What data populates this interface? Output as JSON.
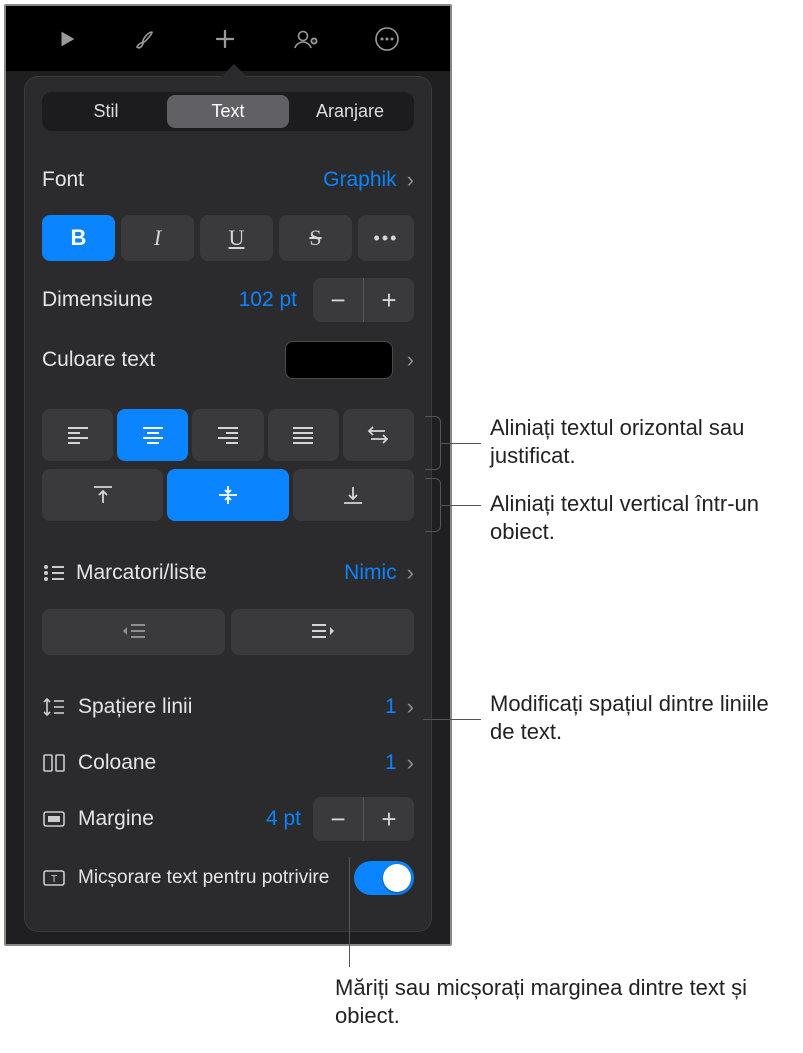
{
  "topbar": {
    "icons": [
      "play-icon",
      "brush-icon",
      "plus-icon",
      "collab-icon",
      "more-icon"
    ]
  },
  "tabs": {
    "stil": "Stil",
    "text": "Text",
    "aranjare": "Aranjare"
  },
  "font": {
    "label": "Font",
    "value": "Graphik"
  },
  "styles": {
    "bold": "B",
    "italic": "I",
    "underline": "U",
    "strike": "S",
    "more": "•••"
  },
  "size": {
    "label": "Dimensiune",
    "value": "102 pt"
  },
  "textcolor": {
    "label": "Culoare text"
  },
  "bullets": {
    "label": "Marcatori/liste",
    "value": "Nimic"
  },
  "linespacing": {
    "label": "Spațiere linii",
    "value": "1"
  },
  "columns": {
    "label": "Coloane",
    "value": "1"
  },
  "margin": {
    "label": "Margine",
    "value": "4 pt"
  },
  "shrink": {
    "label": "Micșorare text pentru potrivire"
  },
  "callouts": {
    "halign": "Aliniați textul orizontal sau justificat.",
    "valign": "Aliniați textul vertical într-un obiect.",
    "lines": "Modificați spațiul dintre liniile de text.",
    "margin": "Măriți sau micșorați marginea dintre text și obiect."
  }
}
